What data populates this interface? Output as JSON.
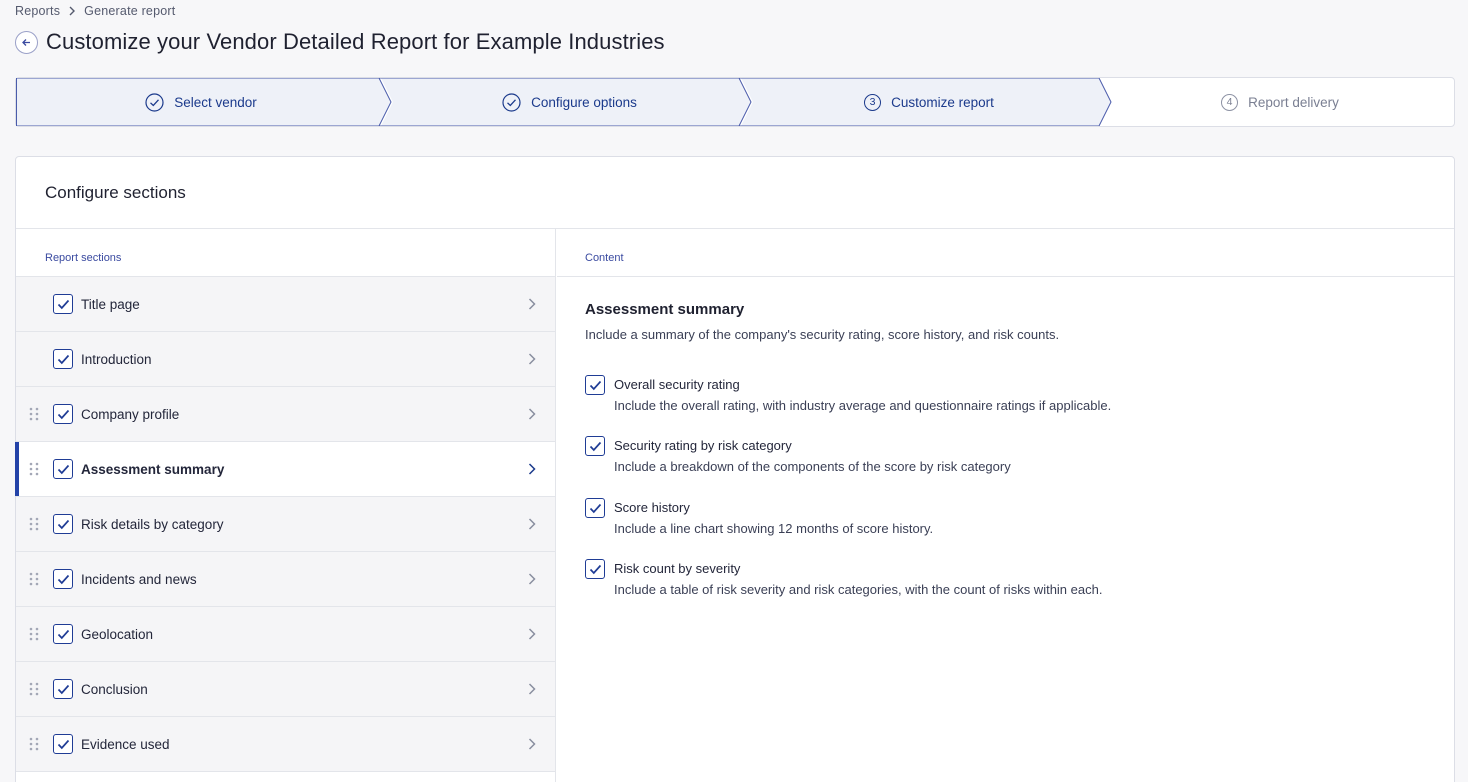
{
  "breadcrumb": {
    "root": "Reports",
    "current": "Generate report"
  },
  "page": {
    "title": "Customize your Vendor Detailed Report for Example Industries"
  },
  "stepper": {
    "steps": [
      {
        "label": "Select vendor",
        "state": "done"
      },
      {
        "label": "Configure options",
        "state": "done"
      },
      {
        "number": "3",
        "label": "Customize report",
        "state": "current"
      },
      {
        "number": "4",
        "label": "Report delivery",
        "state": "todo"
      }
    ]
  },
  "card": {
    "title": "Configure sections",
    "sections_header": "Report sections",
    "content_header": "Content",
    "sections": [
      {
        "label": "Title page",
        "checked": true,
        "draggable": false
      },
      {
        "label": "Introduction",
        "checked": true,
        "draggable": false
      },
      {
        "label": "Company profile",
        "checked": true,
        "draggable": true
      },
      {
        "label": "Assessment summary",
        "checked": true,
        "draggable": true,
        "active": true
      },
      {
        "label": "Risk details by category",
        "checked": true,
        "draggable": true
      },
      {
        "label": "Incidents and news",
        "checked": true,
        "draggable": true
      },
      {
        "label": "Geolocation",
        "checked": true,
        "draggable": true
      },
      {
        "label": "Conclusion",
        "checked": true,
        "draggable": true
      },
      {
        "label": "Evidence used",
        "checked": true,
        "draggable": true
      }
    ],
    "content": {
      "title": "Assessment summary",
      "description": "Include a summary of the company's security rating, score history, and risk counts.",
      "options": [
        {
          "label": "Overall security rating",
          "description": "Include the overall rating, with industry average and questionnaire ratings if applicable.",
          "checked": true
        },
        {
          "label": "Security rating by risk category",
          "description": "Include a breakdown of the components of the score by risk category",
          "checked": true
        },
        {
          "label": "Score history",
          "description": "Include a line chart showing 12 months of score history.",
          "checked": true
        },
        {
          "label": "Risk count by severity",
          "description": "Include a table of risk severity and risk categories, with the count of risks within each.",
          "checked": true
        }
      ]
    }
  },
  "colors": {
    "accent": "#1b3a8c",
    "step_done_bg": "#eef1f8",
    "active_bar": "#2443a8"
  }
}
